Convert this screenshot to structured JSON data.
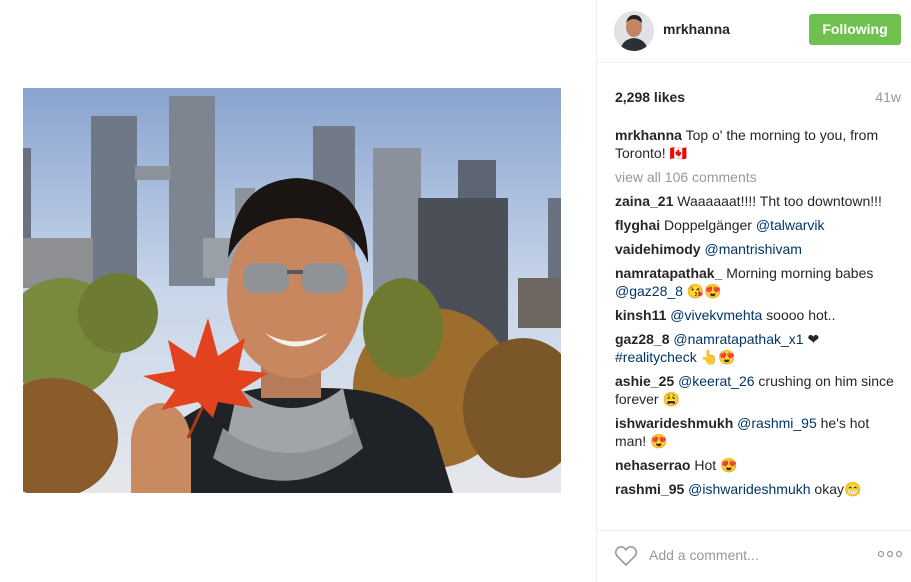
{
  "post": {
    "image_icon": "photo-selfie-toronto-skyline"
  },
  "header": {
    "username": "mrkhanna",
    "follow_label": "Following",
    "follow_color": "#70c050"
  },
  "stats": {
    "likes": "2,298 likes",
    "age": "41w"
  },
  "caption": {
    "username": "mrkhanna",
    "text": "Top o' the morning to you, from Toronto! 🇨🇦"
  },
  "view_all": "view all 106 comments",
  "comments": [
    {
      "user": "zaina_21",
      "text": "Waaaaaat!!!! Tht too downtown!!!"
    },
    {
      "user": "flyghai",
      "text": "Doppelgänger ",
      "mention": "@talwarvik",
      "after": ""
    },
    {
      "user": "vaidehimody",
      "text": "",
      "mention": "@mantrishivam",
      "after": ""
    },
    {
      "user": "namratapathak_",
      "text": "Morning morning babes ",
      "mention": "@gaz28_8",
      "after": " 😘😍"
    },
    {
      "user": "kinsh11",
      "text": "",
      "mention": "@vivekvmehta",
      "after": " soooo hot.."
    },
    {
      "user": "gaz28_8",
      "text": "",
      "mention": "@namratapathak_x1",
      "after": " ❤ ",
      "mention2": "#realitycheck",
      "after2": " 👆😍"
    },
    {
      "user": "ashie_25",
      "text": "",
      "mention": "@keerat_26",
      "after": " crushing on him since forever 😩"
    },
    {
      "user": "ishwarideshmukh",
      "text": "",
      "mention": "@rashmi_95",
      "after": " he's hot man! 😍"
    },
    {
      "user": "nehaserrao",
      "text": "Hot 😍"
    },
    {
      "user": "rashmi_95",
      "text": "",
      "mention": "@ishwarideshmukh",
      "after": " okay😁"
    }
  ],
  "footer": {
    "placeholder": "Add a comment...",
    "like_icon": "heart-outline-icon",
    "more_icon": "more-options-icon"
  }
}
